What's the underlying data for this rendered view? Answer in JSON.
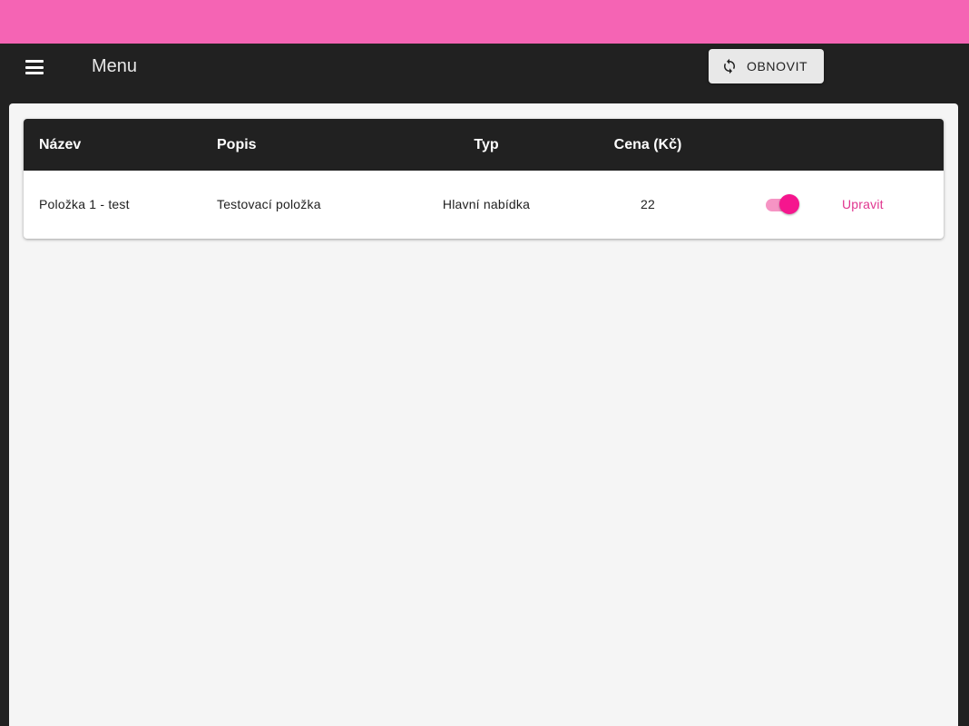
{
  "app_bar": {
    "title": "Menu",
    "refresh_label": "OBNOVIT"
  },
  "table": {
    "headers": {
      "name": "Název",
      "description": "Popis",
      "type": "Typ",
      "price": "Cena (Kč)"
    },
    "rows": [
      {
        "name": "Položka 1 - test",
        "description": "Testovací položka",
        "type": "Hlavní nabídka",
        "price": "22",
        "active": true,
        "edit_label": "Upravit"
      }
    ]
  },
  "icons": {
    "menu": "hamburger-menu-icon",
    "refresh": "refresh-icon"
  },
  "colors": {
    "status_bar": "#f564b4",
    "app_bar": "#212121",
    "accent": "#f5168e",
    "link": "#e0358f",
    "background": "#f5f5f5"
  }
}
